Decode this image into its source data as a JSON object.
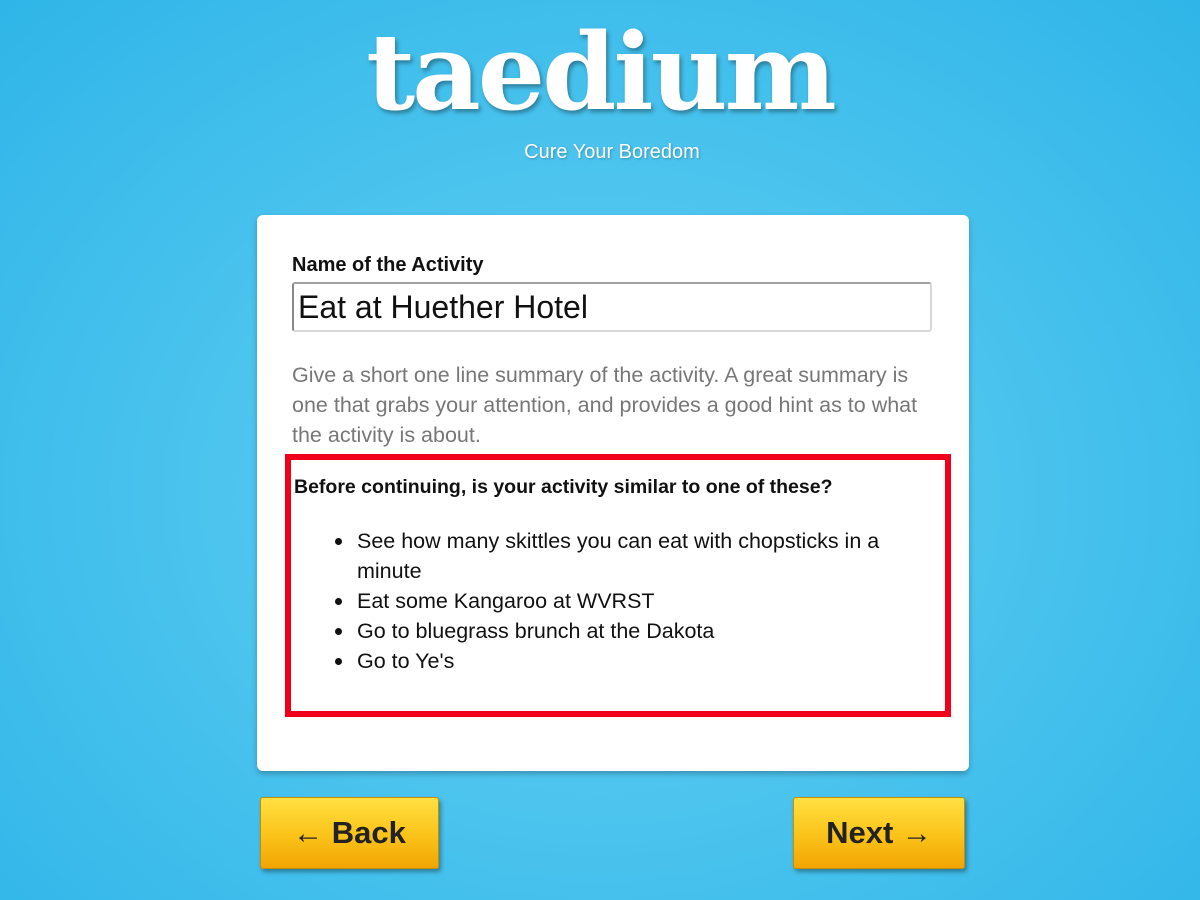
{
  "brand": {
    "logo": "taedium",
    "tagline": "Cure Your Boredom"
  },
  "form": {
    "name_label": "Name of the Activity",
    "name_value": "Eat at Huether Hotel",
    "help_text": "Give a short one line summary of the activity. A great summary is one that grabs your attention, and provides a good hint as to what the activity is about."
  },
  "similar": {
    "title": "Before continuing, is your activity similar to one of these?",
    "items": [
      "See how many skittles you can eat with chopsticks in a minute",
      "Eat some Kangaroo at WVRST",
      "Go to bluegrass brunch at the Dakota",
      "Go to Ye's"
    ],
    "border_color": "#f0001a"
  },
  "nav": {
    "back_arrow": "←",
    "back_label": "Back",
    "next_label": "Next",
    "next_arrow": "→"
  },
  "colors": {
    "background": "#4cc4ee",
    "button": "#fbc51c"
  }
}
